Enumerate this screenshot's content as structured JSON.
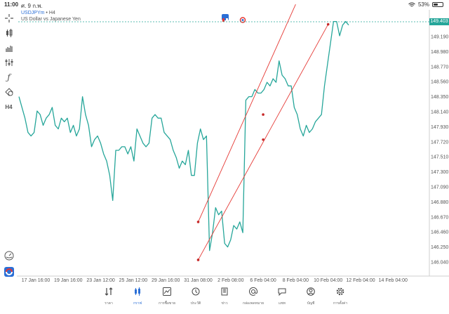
{
  "status": {
    "time": "11:00",
    "date": "ศ. 9 ก.พ.",
    "battery": "53%",
    "battery_level": 0.53
  },
  "symbol": {
    "name": "USDJPYm",
    "separator": "•",
    "timeframe": "H4",
    "description": "US Dollar vs Japanese Yen"
  },
  "toolbar": {
    "items": [
      {
        "name": "crosshair-icon",
        "label": ""
      },
      {
        "name": "candle-chart-icon",
        "label": ""
      },
      {
        "name": "bar-chart-icon",
        "label": ""
      },
      {
        "name": "indicators-icon",
        "label": ""
      },
      {
        "name": "function-icon",
        "label": "ƒ"
      },
      {
        "name": "objects-icon",
        "label": ""
      },
      {
        "name": "timeframe-button",
        "label": "H4"
      }
    ]
  },
  "price_tag": "149.403",
  "colors": {
    "line": "#26a69a",
    "channel": "#e53935",
    "accent": "#2b6fd6"
  },
  "chart_data": {
    "type": "line",
    "y_ticks": [
      "149.190",
      "148.980",
      "148.770",
      "148.560",
      "148.350",
      "148.140",
      "147.930",
      "147.720",
      "147.510",
      "147.300",
      "147.090",
      "146.880",
      "146.670",
      "146.460",
      "146.250",
      "146.040"
    ],
    "x_ticks": [
      "17 Jan 16:00",
      "19 Jan 16:00",
      "23 Jan 12:00",
      "25 Jan 12:00",
      "29 Jan 16:00",
      "31 Jan 08:00",
      "2 Feb 08:00",
      "6 Feb 04:00",
      "8 Feb 04:00",
      "10 Feb 04:00",
      "12 Feb 04:00",
      "14 Feb 04:00"
    ],
    "current_price": 149.403,
    "series_close": [
      148.35,
      148.2,
      148.05,
      147.85,
      147.8,
      147.85,
      148.15,
      148.1,
      147.95,
      148.05,
      148.1,
      148.2,
      147.95,
      147.9,
      148.05,
      148.0,
      148.05,
      147.85,
      147.95,
      147.8,
      147.9,
      148.35,
      148.1,
      147.95,
      147.65,
      147.75,
      147.8,
      147.7,
      147.55,
      147.45,
      147.25,
      146.9,
      147.6,
      147.6,
      147.65,
      147.65,
      147.55,
      147.65,
      147.45,
      147.9,
      147.8,
      147.7,
      147.65,
      147.7,
      148.05,
      148.1,
      148.05,
      148.05,
      147.85,
      147.8,
      147.75,
      147.6,
      147.5,
      147.35,
      147.45,
      147.4,
      147.6,
      147.25,
      147.25,
      147.7,
      147.9,
      147.75,
      147.8,
      146.2,
      146.45,
      146.8,
      146.7,
      146.75,
      146.3,
      146.25,
      146.35,
      146.55,
      146.5,
      146.6,
      146.45,
      148.3,
      148.35,
      148.35,
      148.45,
      148.4,
      148.4,
      148.45,
      148.55,
      148.5,
      148.6,
      148.55,
      148.85,
      148.65,
      148.6,
      148.5,
      148.5,
      148.2,
      148.1,
      147.9,
      147.8,
      147.95,
      147.85,
      147.9,
      148.0,
      148.05,
      148.1,
      148.5,
      148.8,
      149.1,
      149.4,
      149.4,
      149.2,
      149.35,
      149.4,
      149.35
    ],
    "channel_lines": [
      {
        "start": {
          "x": "31 Jan 08:00",
          "y": 146.6
        },
        "end": {
          "x": "8 Feb 04:00",
          "y": 149.64
        }
      },
      {
        "start": {
          "x": "31 Jan 08:00",
          "y": 146.07
        },
        "end": {
          "x": "10 Feb 04:00",
          "y": 149.36
        }
      }
    ],
    "channel_points": [
      {
        "x": "31 Jan 08:00",
        "y": 146.6
      },
      {
        "x": "6 Feb 04:00",
        "y": 148.1
      },
      {
        "x": "31 Jan 08:00",
        "y": 146.07
      },
      {
        "x": "6 Feb 04:00",
        "y": 147.75
      },
      {
        "x": "10 Feb 04:00",
        "y": 149.36
      }
    ]
  },
  "bottom_nav": {
    "items": [
      {
        "name": "nav-quotes",
        "icon": "quotes-icon",
        "label": "ราคา"
      },
      {
        "name": "nav-chart",
        "icon": "chart-icon",
        "label": "กราฟ",
        "active": true
      },
      {
        "name": "nav-trade",
        "icon": "trade-icon",
        "label": "การซื้อขาย"
      },
      {
        "name": "nav-history",
        "icon": "history-icon",
        "label": "ประวัติ"
      },
      {
        "name": "nav-news",
        "icon": "news-icon",
        "label": "ข่าว"
      },
      {
        "name": "nav-mailbox",
        "icon": "mailbox-icon",
        "label": "กล่องจดหมาย"
      },
      {
        "name": "nav-chat",
        "icon": "chat-icon",
        "label": "แชท"
      },
      {
        "name": "nav-accounts",
        "icon": "account-icon",
        "label": "บัญชี"
      },
      {
        "name": "nav-settings",
        "icon": "settings-icon",
        "label": "การตั้งค่า"
      }
    ]
  }
}
